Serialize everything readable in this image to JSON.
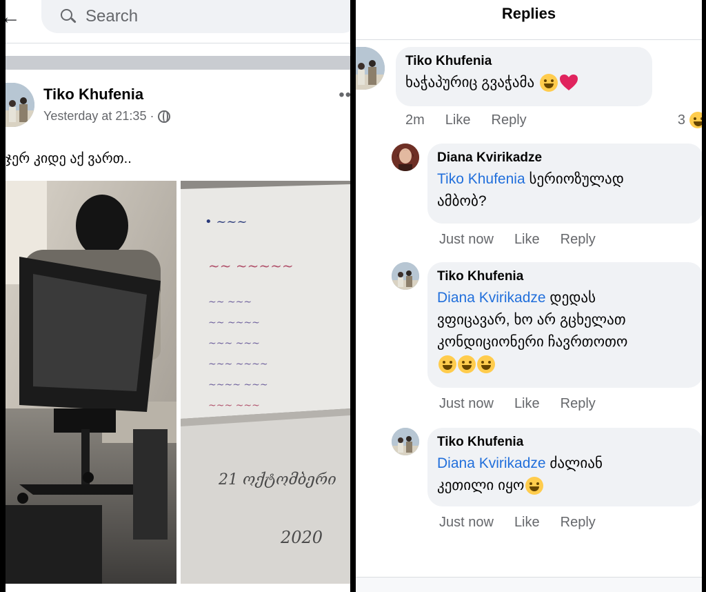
{
  "left": {
    "search": {
      "placeholder": "Search"
    },
    "post": {
      "author": "Tiko Khufenia",
      "timestamp": "Yesterday at 21:35 ·",
      "text": "ჯერ კიდე აქ ვართ..",
      "photo_texts": [
        "21 ოქტომბერი",
        "2020"
      ]
    }
  },
  "right": {
    "title": "Replies",
    "comments": [
      {
        "name": "Tiko Khufenia",
        "mention": "",
        "text": "ხაჭაპურიც გვაჭამა",
        "time": "2m",
        "like": "Like",
        "reply": "Reply",
        "reaction_count": "3"
      },
      {
        "name": "Diana Kvirikadze",
        "mention": "Tiko Khufenia",
        "text": "სერიოზულად",
        "text2": "ამბობ?",
        "time": "Just now",
        "like": "Like",
        "reply": "Reply"
      },
      {
        "name": "Tiko Khufenia",
        "mention": "Diana Kvirikadze",
        "text": "დედას",
        "text2": "ვფიცავარ, ხო არ გცხელათ",
        "text3": "კონდიციონერი ჩავრთოთო",
        "time": "Just now",
        "like": "Like",
        "reply": "Reply"
      },
      {
        "name": "Tiko Khufenia",
        "mention": "Diana Kvirikadze",
        "text": "ძალიან",
        "text2": "კეთილი იყო",
        "time": "Just now",
        "like": "Like",
        "reply": "Reply"
      }
    ]
  },
  "icons": {
    "back": "back-arrow-icon",
    "search": "search-icon",
    "globe": "globe-icon",
    "more": "more-icon",
    "emoji": "grinning-emoji-icon",
    "heart": "heart-icon"
  },
  "colors": {
    "mention": "#216fdb",
    "bubble": "#f0f2f5",
    "meta": "#65676b"
  }
}
